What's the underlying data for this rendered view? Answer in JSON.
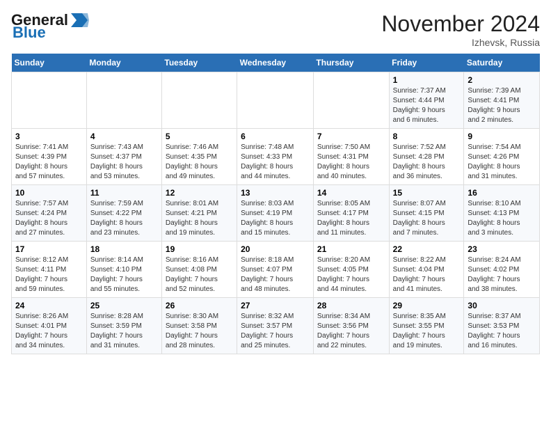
{
  "header": {
    "logo_general": "General",
    "logo_blue": "Blue",
    "month_title": "November 2024",
    "location": "Izhevsk, Russia"
  },
  "days_of_week": [
    "Sunday",
    "Monday",
    "Tuesday",
    "Wednesday",
    "Thursday",
    "Friday",
    "Saturday"
  ],
  "weeks": [
    [
      {
        "day": "",
        "info": ""
      },
      {
        "day": "",
        "info": ""
      },
      {
        "day": "",
        "info": ""
      },
      {
        "day": "",
        "info": ""
      },
      {
        "day": "",
        "info": ""
      },
      {
        "day": "1",
        "info": "Sunrise: 7:37 AM\nSunset: 4:44 PM\nDaylight: 9 hours\nand 6 minutes."
      },
      {
        "day": "2",
        "info": "Sunrise: 7:39 AM\nSunset: 4:41 PM\nDaylight: 9 hours\nand 2 minutes."
      }
    ],
    [
      {
        "day": "3",
        "info": "Sunrise: 7:41 AM\nSunset: 4:39 PM\nDaylight: 8 hours\nand 57 minutes."
      },
      {
        "day": "4",
        "info": "Sunrise: 7:43 AM\nSunset: 4:37 PM\nDaylight: 8 hours\nand 53 minutes."
      },
      {
        "day": "5",
        "info": "Sunrise: 7:46 AM\nSunset: 4:35 PM\nDaylight: 8 hours\nand 49 minutes."
      },
      {
        "day": "6",
        "info": "Sunrise: 7:48 AM\nSunset: 4:33 PM\nDaylight: 8 hours\nand 44 minutes."
      },
      {
        "day": "7",
        "info": "Sunrise: 7:50 AM\nSunset: 4:31 PM\nDaylight: 8 hours\nand 40 minutes."
      },
      {
        "day": "8",
        "info": "Sunrise: 7:52 AM\nSunset: 4:28 PM\nDaylight: 8 hours\nand 36 minutes."
      },
      {
        "day": "9",
        "info": "Sunrise: 7:54 AM\nSunset: 4:26 PM\nDaylight: 8 hours\nand 31 minutes."
      }
    ],
    [
      {
        "day": "10",
        "info": "Sunrise: 7:57 AM\nSunset: 4:24 PM\nDaylight: 8 hours\nand 27 minutes."
      },
      {
        "day": "11",
        "info": "Sunrise: 7:59 AM\nSunset: 4:22 PM\nDaylight: 8 hours\nand 23 minutes."
      },
      {
        "day": "12",
        "info": "Sunrise: 8:01 AM\nSunset: 4:21 PM\nDaylight: 8 hours\nand 19 minutes."
      },
      {
        "day": "13",
        "info": "Sunrise: 8:03 AM\nSunset: 4:19 PM\nDaylight: 8 hours\nand 15 minutes."
      },
      {
        "day": "14",
        "info": "Sunrise: 8:05 AM\nSunset: 4:17 PM\nDaylight: 8 hours\nand 11 minutes."
      },
      {
        "day": "15",
        "info": "Sunrise: 8:07 AM\nSunset: 4:15 PM\nDaylight: 8 hours\nand 7 minutes."
      },
      {
        "day": "16",
        "info": "Sunrise: 8:10 AM\nSunset: 4:13 PM\nDaylight: 8 hours\nand 3 minutes."
      }
    ],
    [
      {
        "day": "17",
        "info": "Sunrise: 8:12 AM\nSunset: 4:11 PM\nDaylight: 7 hours\nand 59 minutes."
      },
      {
        "day": "18",
        "info": "Sunrise: 8:14 AM\nSunset: 4:10 PM\nDaylight: 7 hours\nand 55 minutes."
      },
      {
        "day": "19",
        "info": "Sunrise: 8:16 AM\nSunset: 4:08 PM\nDaylight: 7 hours\nand 52 minutes."
      },
      {
        "day": "20",
        "info": "Sunrise: 8:18 AM\nSunset: 4:07 PM\nDaylight: 7 hours\nand 48 minutes."
      },
      {
        "day": "21",
        "info": "Sunrise: 8:20 AM\nSunset: 4:05 PM\nDaylight: 7 hours\nand 44 minutes."
      },
      {
        "day": "22",
        "info": "Sunrise: 8:22 AM\nSunset: 4:04 PM\nDaylight: 7 hours\nand 41 minutes."
      },
      {
        "day": "23",
        "info": "Sunrise: 8:24 AM\nSunset: 4:02 PM\nDaylight: 7 hours\nand 38 minutes."
      }
    ],
    [
      {
        "day": "24",
        "info": "Sunrise: 8:26 AM\nSunset: 4:01 PM\nDaylight: 7 hours\nand 34 minutes."
      },
      {
        "day": "25",
        "info": "Sunrise: 8:28 AM\nSunset: 3:59 PM\nDaylight: 7 hours\nand 31 minutes."
      },
      {
        "day": "26",
        "info": "Sunrise: 8:30 AM\nSunset: 3:58 PM\nDaylight: 7 hours\nand 28 minutes."
      },
      {
        "day": "27",
        "info": "Sunrise: 8:32 AM\nSunset: 3:57 PM\nDaylight: 7 hours\nand 25 minutes."
      },
      {
        "day": "28",
        "info": "Sunrise: 8:34 AM\nSunset: 3:56 PM\nDaylight: 7 hours\nand 22 minutes."
      },
      {
        "day": "29",
        "info": "Sunrise: 8:35 AM\nSunset: 3:55 PM\nDaylight: 7 hours\nand 19 minutes."
      },
      {
        "day": "30",
        "info": "Sunrise: 8:37 AM\nSunset: 3:53 PM\nDaylight: 7 hours\nand 16 minutes."
      }
    ]
  ]
}
